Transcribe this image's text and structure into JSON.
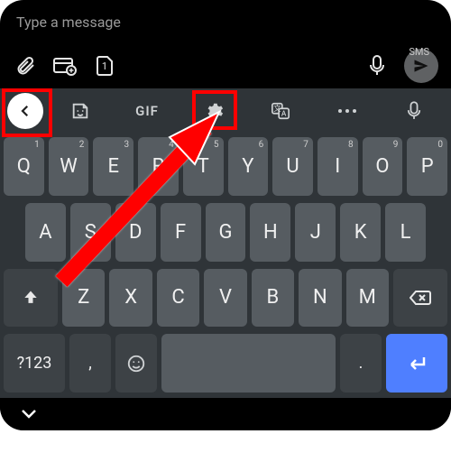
{
  "message_input": {
    "placeholder": "Type a message"
  },
  "send": {
    "label": "SMS"
  },
  "kb_toolbar": {
    "gif": "GIF"
  },
  "rows": {
    "r1": [
      {
        "k": "Q",
        "s": "1"
      },
      {
        "k": "W",
        "s": "2"
      },
      {
        "k": "E",
        "s": "3"
      },
      {
        "k": "R",
        "s": "4"
      },
      {
        "k": "T",
        "s": "5"
      },
      {
        "k": "Y",
        "s": "6"
      },
      {
        "k": "U",
        "s": "7"
      },
      {
        "k": "I",
        "s": "8"
      },
      {
        "k": "O",
        "s": "9"
      },
      {
        "k": "P",
        "s": "0"
      }
    ],
    "r2": [
      {
        "k": "A"
      },
      {
        "k": "S"
      },
      {
        "k": "D"
      },
      {
        "k": "F"
      },
      {
        "k": "G"
      },
      {
        "k": "H"
      },
      {
        "k": "J"
      },
      {
        "k": "K"
      },
      {
        "k": "L"
      }
    ],
    "r3": [
      {
        "k": "Z"
      },
      {
        "k": "X"
      },
      {
        "k": "C"
      },
      {
        "k": "V"
      },
      {
        "k": "B"
      },
      {
        "k": "N"
      },
      {
        "k": "M"
      }
    ]
  },
  "bottom": {
    "symbols": "?123",
    "comma": ",",
    "period": "."
  }
}
